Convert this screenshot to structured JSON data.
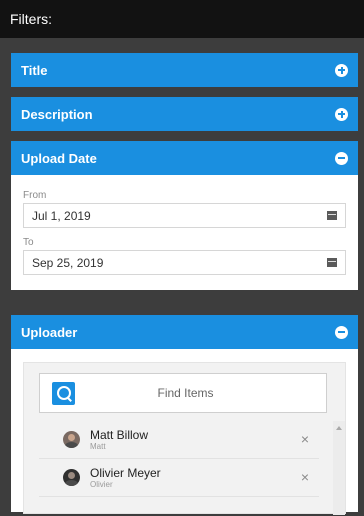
{
  "topbar": {
    "title": "Filters:"
  },
  "panels": {
    "title": {
      "label": "Title"
    },
    "description": {
      "label": "Description"
    },
    "upload_date": {
      "label": "Upload Date",
      "from_label": "From",
      "from_value": "Jul 1, 2019",
      "to_label": "To",
      "to_value": "Sep 25, 2019"
    },
    "uploader": {
      "label": "Uploader",
      "search_placeholder": "Find Items",
      "results": [
        {
          "name": "Matt Billow",
          "sub": "Matt"
        },
        {
          "name": "Olivier Meyer",
          "sub": "Olivier"
        }
      ],
      "remove_glyph": "×"
    }
  },
  "colors": {
    "accent": "#1a8fe0",
    "topbar": "#121212",
    "background": "#3d3d3d"
  },
  "icons": {
    "expand": "plus-circle-icon",
    "collapse": "minus-circle-icon",
    "calendar": "calendar-icon",
    "search": "search-icon",
    "remove": "close-icon"
  }
}
